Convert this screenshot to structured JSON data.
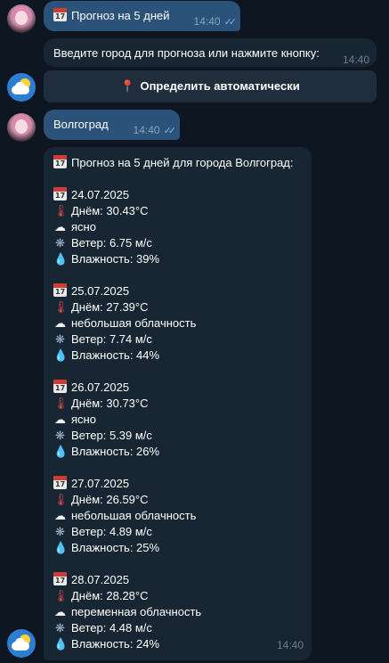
{
  "messages": {
    "user_cmd": {
      "text": "Прогноз на 5 дней",
      "time": "14:40"
    },
    "bot_prompt": {
      "text": "Введите город для прогноза или нажмите кнопку:",
      "time": "14:40"
    },
    "keyboard_button": "Определить автоматически",
    "user_city": {
      "text": "Волгоград",
      "time": "14:40"
    },
    "forecast": {
      "header": "Прогноз на 5 дней для города Волгоград:",
      "time": "14:40",
      "days": [
        {
          "date": "24.07.2025",
          "temp": "Днём: 30.43°C",
          "desc": "ясно",
          "wind": "Ветер: 6.75 м/с",
          "humidity": "Влажность: 39%"
        },
        {
          "date": "25.07.2025",
          "temp": "Днём: 27.39°C",
          "desc": "небольшая облачность",
          "wind": "Ветер: 7.74 м/с",
          "humidity": "Влажность: 44%"
        },
        {
          "date": "26.07.2025",
          "temp": "Днём: 30.73°C",
          "desc": "ясно",
          "wind": "Ветер: 5.39 м/с",
          "humidity": "Влажность: 26%"
        },
        {
          "date": "27.07.2025",
          "temp": "Днём: 26.59°C",
          "desc": "небольшая облачность",
          "wind": "Ветер: 4.89 м/с",
          "humidity": "Влажность: 25%"
        },
        {
          "date": "28.07.2025",
          "temp": "Днём: 28.28°C",
          "desc": "переменная облачность",
          "wind": "Ветер: 4.48 м/с",
          "humidity": "Влажность: 24%"
        }
      ]
    }
  },
  "icons": {
    "calendar": "calendar-icon",
    "thermometer": "thermometer-icon",
    "cloud": "cloud-icon",
    "wind": "wind-icon",
    "droplet": "droplet-icon",
    "pin": "pin-icon"
  }
}
